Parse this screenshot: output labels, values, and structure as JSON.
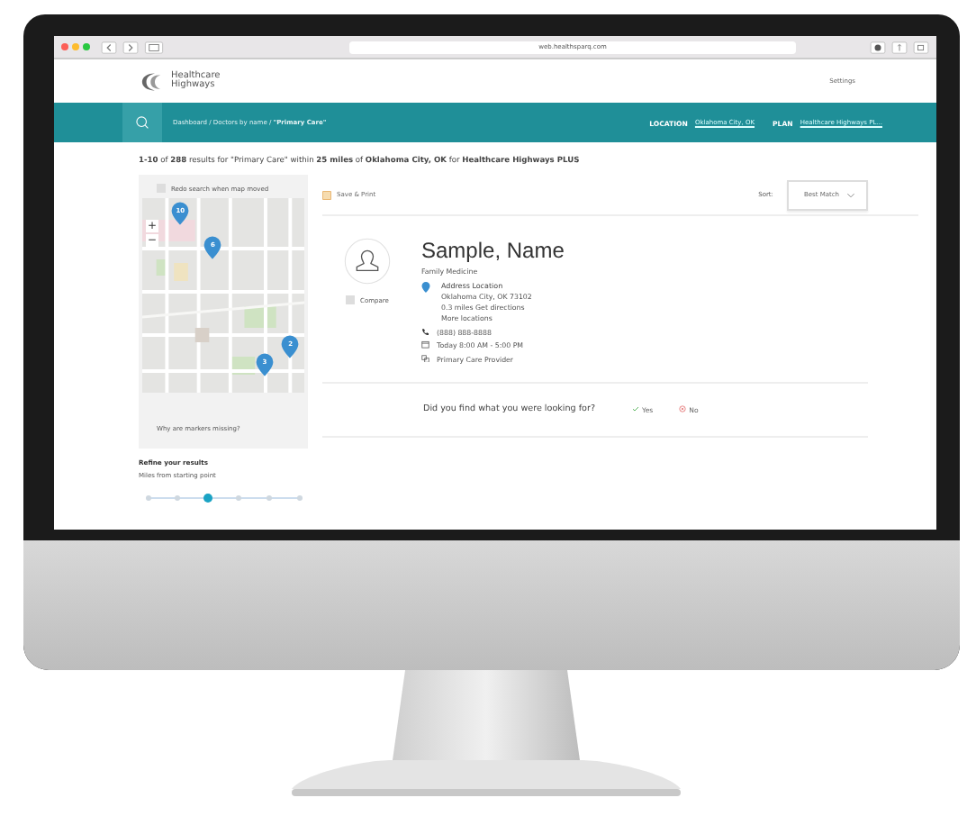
{
  "browser": {
    "url": "web.healthsparq.com"
  },
  "header": {
    "logo": "Healthcare Highways",
    "settings": "Settings"
  },
  "nav": {
    "breadcrumb": "Dashboard / Doctors by name / **\"Primary Care\"**",
    "location_label": "LOCATION",
    "location": "Oklahoma City, OK",
    "plan_label": "PLAN",
    "plan": "Healthcare Highways PL..."
  },
  "summary": "**1-10** of **288** results for \"Primary Care\" within **25 miles** of **Oklahoma City, OK** for **Healthcare Highways PLUS**",
  "map_panel": {
    "redo_search": {
      "label": "Redo search when map moved",
      "checked": false
    },
    "zoom_in": "+",
    "zoom_out": "−",
    "markers": [
      {
        "label": "10"
      },
      {
        "label": "6"
      },
      {
        "label": "2"
      },
      {
        "label": "3"
      }
    ],
    "missing_link": "Why are markers missing?"
  },
  "refine": {
    "title": "Refine your results",
    "distance_label": "Miles from starting point",
    "distance": {
      "level": 0.4
    }
  },
  "toolbar": {
    "save_print": "Save & Print",
    "sort_label": "Sort:",
    "sort_value": "Best Match"
  },
  "result": {
    "name": "Sample, Name",
    "specialty": "Family Medicine",
    "compare": {
      "label": "Compare",
      "checked": false
    },
    "address_title": "Address Location",
    "address_city": "Oklahoma City, OK 73102",
    "distance": "0.3 miles",
    "directions": "Get directions",
    "more_locations": "More locations",
    "phone": "(888) 888-8888",
    "hours": "Today 8:00 AM - 5:00 PM",
    "role": "Primary Care Provider"
  },
  "feedback": {
    "question": "Did you find what you were looking for?",
    "yes": "Yes",
    "no": "No"
  }
}
